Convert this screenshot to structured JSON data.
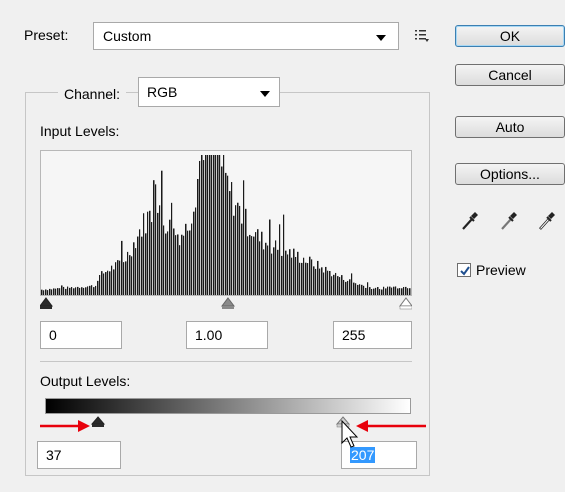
{
  "preset": {
    "label": "Preset:",
    "value": "Custom"
  },
  "buttons": {
    "ok": "OK",
    "cancel": "Cancel",
    "auto": "Auto",
    "options": "Options..."
  },
  "preview": {
    "label": "Preview",
    "checked": true
  },
  "channel": {
    "label": "Channel:",
    "value": "RGB"
  },
  "input_levels": {
    "label": "Input Levels:",
    "black": "0",
    "gamma": "1.00",
    "white": "255"
  },
  "output_levels": {
    "label": "Output Levels:",
    "black": "37",
    "white": "207"
  },
  "colors": {
    "annotation_arrow": "#e8000b",
    "selection": "#3399ff",
    "histogram_bars": "#1a1a1a"
  }
}
